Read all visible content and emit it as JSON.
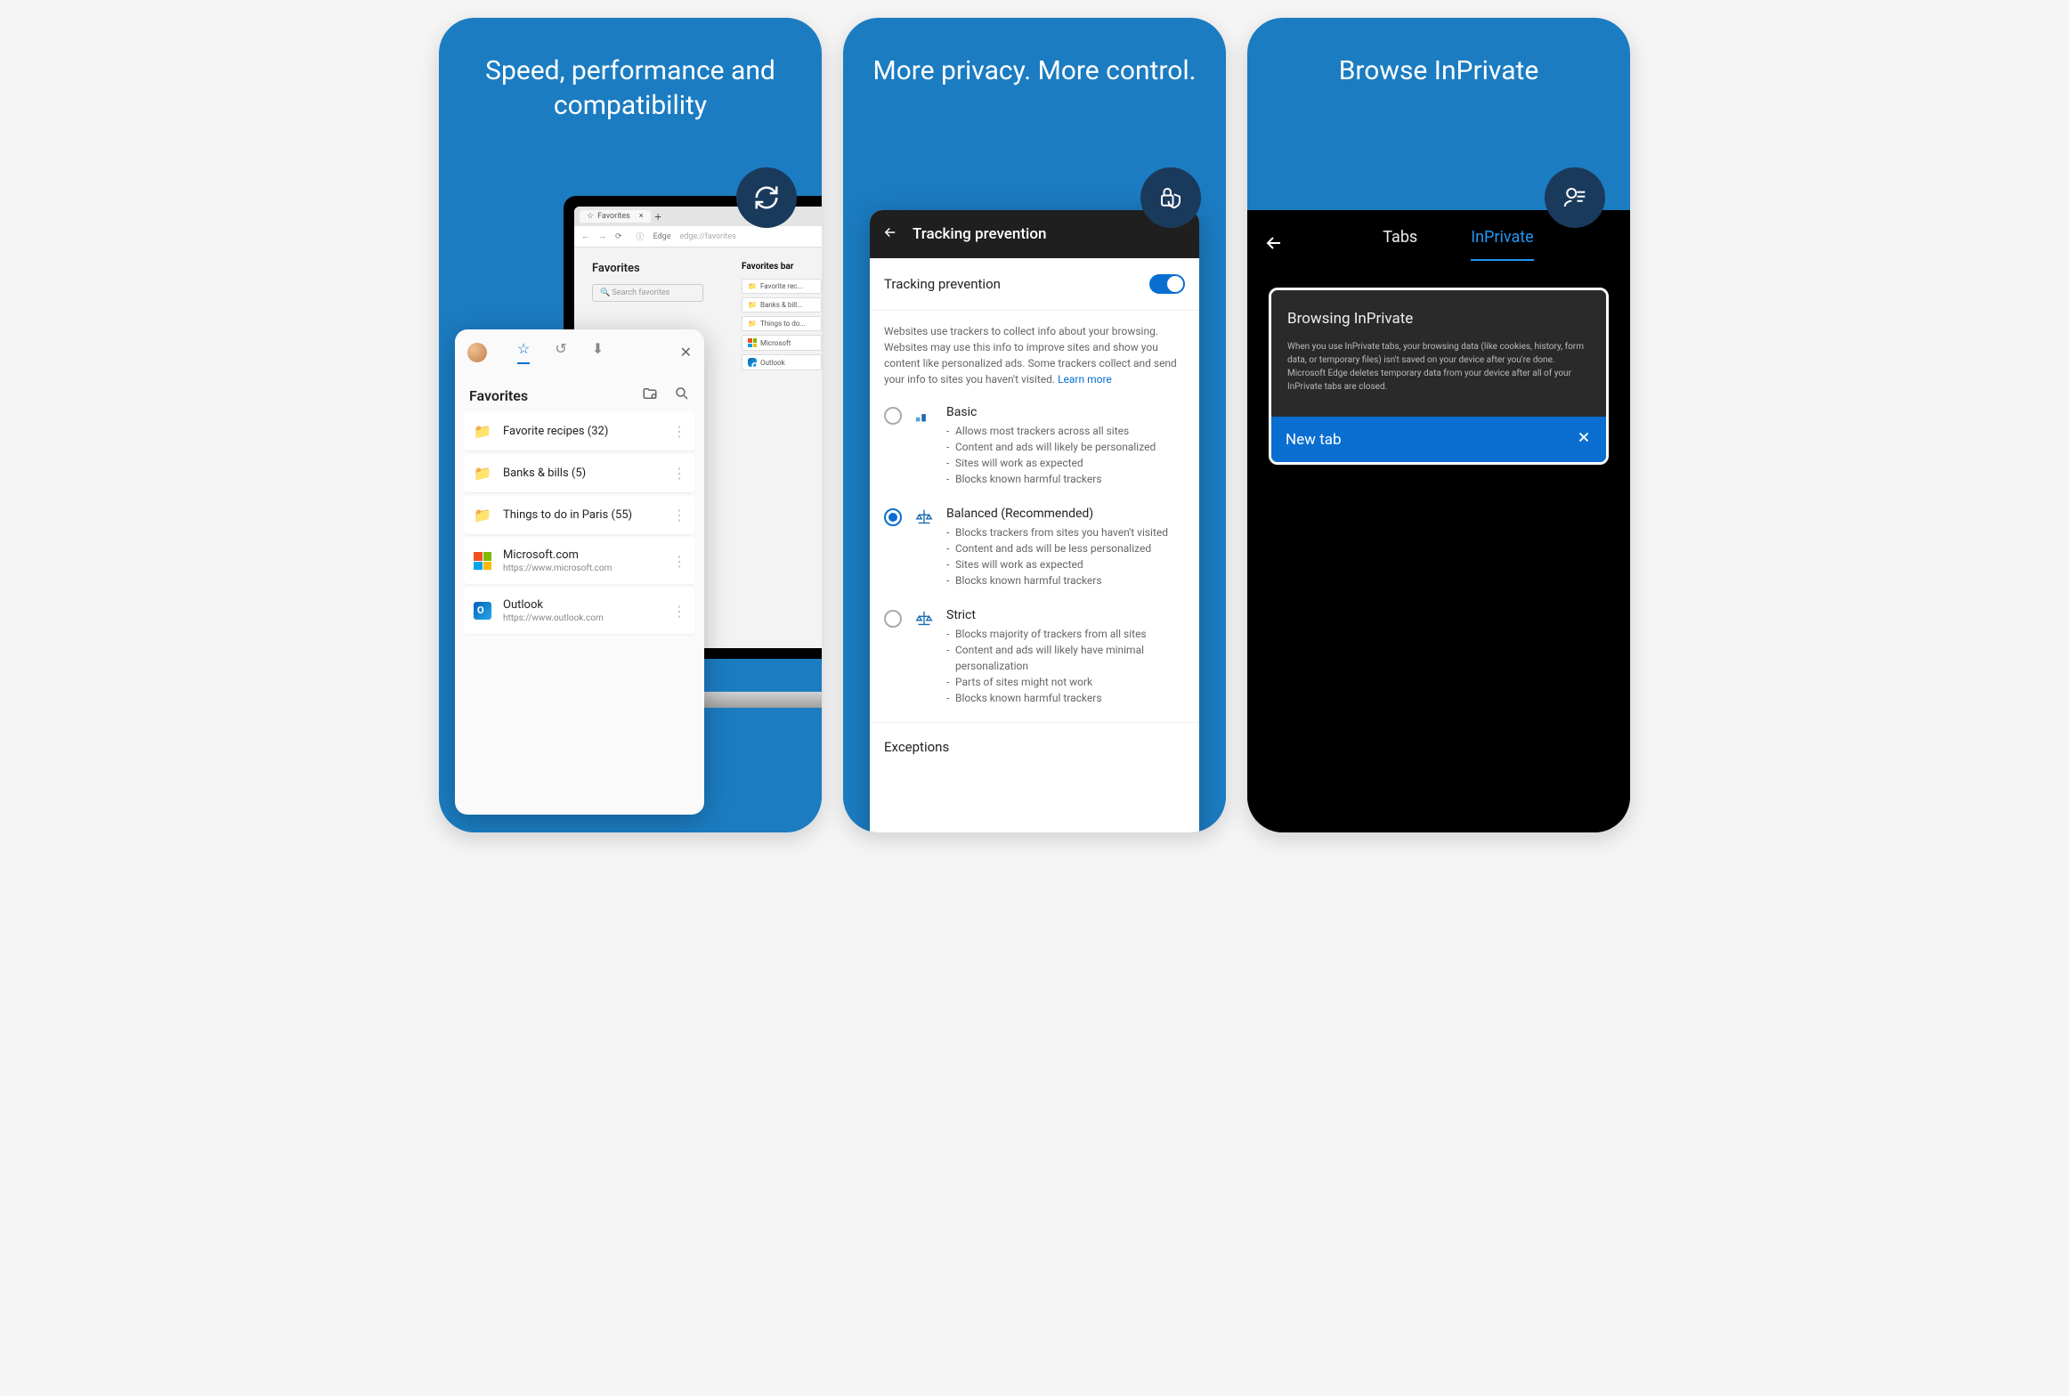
{
  "cards": [
    {
      "title": "Speed, performance and compatibility",
      "badge_icon": "sync-icon",
      "laptop": {
        "tab_label": "Favorites",
        "address_prefix": "Edge",
        "address_url": "edge://favorites",
        "page_heading": "Favorites",
        "search_placeholder": "Search favorites",
        "bar_heading": "Favorites bar",
        "bar_items": [
          "Favorite rec...",
          "Banks & bill...",
          "Things to do...",
          "Microsoft",
          "Outlook"
        ]
      },
      "phone": {
        "heading": "Favorites",
        "items": [
          {
            "title": "Favorite recipes (32)",
            "icon": "folder-icon"
          },
          {
            "title": "Banks & bills (5)",
            "icon": "folder-icon"
          },
          {
            "title": "Things to do in Paris (55)",
            "icon": "folder-icon"
          },
          {
            "title": "Microsoft.com",
            "sub": "https://www.microsoft.com",
            "icon": "ms-logo"
          },
          {
            "title": "Outlook",
            "sub": "https://www.outlook.com",
            "icon": "outlook-logo"
          }
        ]
      }
    },
    {
      "title": "More privacy. More control.",
      "badge_icon": "lock-shield-icon",
      "header": "Tracking prevention",
      "toggle_label": "Tracking prevention",
      "description": "Websites use trackers to collect info about your browsing. Websites may use this info to improve sites and show you content like personalized ads. Some trackers collect and send your info to sites you haven't visited.",
      "learn_more": "Learn more",
      "options": [
        {
          "title": "Basic",
          "selected": false,
          "bullets": [
            "Allows most trackers across all sites",
            "Content and ads will likely be personalized",
            "Sites will work as expected",
            "Blocks known harmful trackers"
          ]
        },
        {
          "title": "Balanced (Recommended)",
          "selected": true,
          "bullets": [
            "Blocks trackers from sites you haven't visited",
            "Content and ads will be less personalized",
            "Sites will work as expected",
            "Blocks known harmful trackers"
          ]
        },
        {
          "title": "Strict",
          "selected": false,
          "bullets": [
            "Blocks majority of trackers from all sites",
            "Content and ads will likely have minimal personalization",
            "Parts of sites might not work",
            "Blocks known harmful trackers"
          ]
        }
      ],
      "exceptions": "Exceptions"
    },
    {
      "title": "Browse InPrivate",
      "badge_icon": "inprivate-icon",
      "tabs": {
        "normal": "Tabs",
        "private": "InPrivate"
      },
      "panel": {
        "heading": "Browsing InPrivate",
        "body": "When you use InPrivate tabs, your browsing data (like cookies, history, form data, or temporary files) isn't saved on your device after you're done. Microsoft Edge deletes temporary data from your device after all of your InPrivate tabs are closed.",
        "new_tab": "New tab"
      }
    }
  ]
}
